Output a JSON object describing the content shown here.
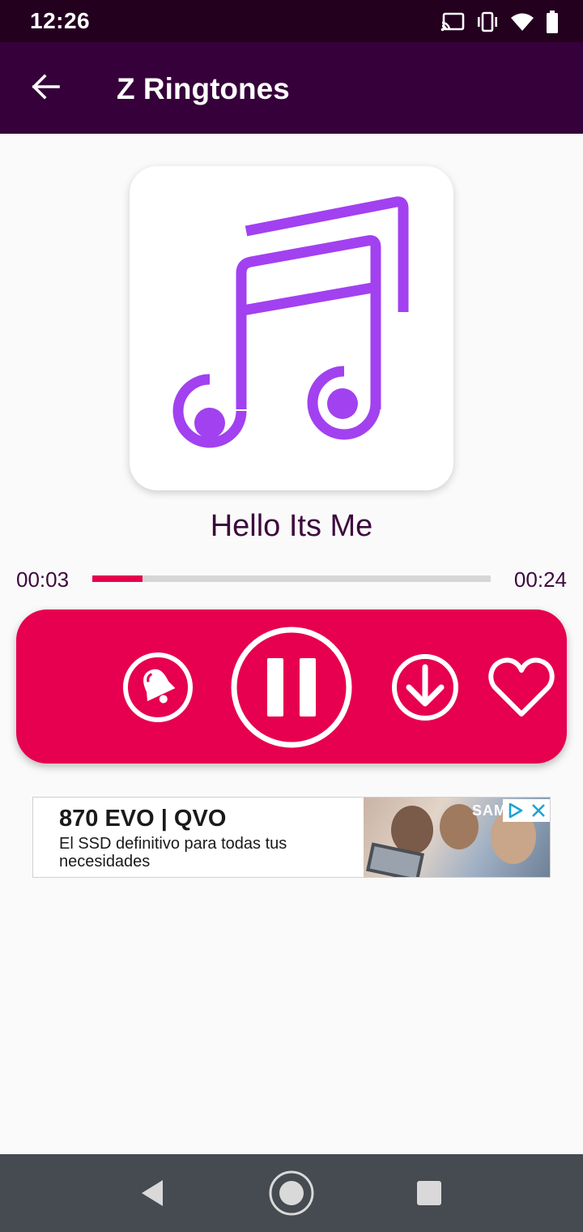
{
  "status_bar": {
    "time": "12:26",
    "icons": [
      "cast-icon",
      "vibrate-icon",
      "wifi-icon",
      "battery-icon"
    ]
  },
  "toolbar": {
    "back_icon": "arrow-left-icon",
    "title": "Z Ringtones",
    "background": "#36003a"
  },
  "artwork": {
    "icon": "music-note-icon",
    "icon_color": "#a241f0"
  },
  "player": {
    "song_title": "Hello Its Me",
    "current_time": "00:03",
    "total_time": "00:24",
    "progress_fraction": 0.125,
    "accent": "#e6004f"
  },
  "controls": {
    "buttons": [
      "set-ringtone-icon",
      "pause-icon",
      "download-icon",
      "favorite-icon"
    ]
  },
  "ad": {
    "headline": "870 EVO | QVO",
    "body": "El SSD definitivo para todas tus necesidades",
    "brand": "SAM"
  },
  "nav_bar": {
    "buttons": [
      "back-triangle-icon",
      "home-circle-icon",
      "recents-square-icon"
    ]
  }
}
